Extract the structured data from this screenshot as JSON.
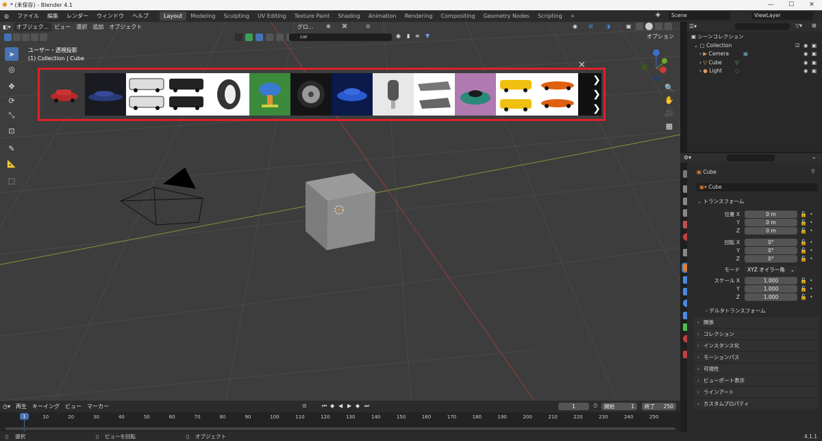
{
  "window": {
    "title": "* (未保存) - Blender 4.1",
    "minimize": "—",
    "maximize": "☐",
    "close": "✕"
  },
  "menu": [
    "ファイル",
    "編集",
    "レンダー",
    "ウィンドウ",
    "ヘルプ"
  ],
  "workspaces": [
    "Layout",
    "Modeling",
    "Sculpting",
    "UV Editing",
    "Texture Paint",
    "Shading",
    "Animation",
    "Rendering",
    "Compositing",
    "Geometry Nodes",
    "Scripting"
  ],
  "add_workspace": "+",
  "scene": {
    "label": "Scene",
    "viewlayer": "ViewLayer"
  },
  "viewport": {
    "mode": "オブジェク...",
    "menus": [
      "ビュー",
      "選択",
      "追加",
      "オブジェクト"
    ],
    "transform": "グロ...",
    "search_value": "car",
    "options": "オプション",
    "view_label": "ユーザー・透視投影",
    "collection_label": "(1) Collection | Cube",
    "close": "✕"
  },
  "asset_strip": {
    "items": [
      "red-classic-car",
      "blue-sports-car",
      "police-suv",
      "tire",
      "spring-rider-toy",
      "alloy-wheel",
      "blue-sedan",
      "car-key",
      "wrecked-car",
      "bumper-car",
      "yellow-taxi",
      "orange-supercar"
    ],
    "next_arrows": [
      "❯",
      "❯",
      "❯"
    ]
  },
  "outliner": {
    "root": "シーンコレクション",
    "collection": "Collection",
    "items": [
      "Camera",
      "Cube",
      "Light"
    ]
  },
  "properties": {
    "object_name": "Cube",
    "datablock": "Cube",
    "transform_header": "トランスフォーム",
    "location_label": "位置 X",
    "rotation_label": "回転 X",
    "scale_label": "スケール X",
    "y": "Y",
    "z": "Z",
    "location": [
      "0 m",
      "0 m",
      "0 m"
    ],
    "rotation": [
      "0°",
      "0°",
      "0°"
    ],
    "scale": [
      "1.000",
      "1.000",
      "1.000"
    ],
    "mode_label": "モード",
    "mode_value": "XYZ オイラー角",
    "delta": "デルタトランスフォーム",
    "sections": [
      "関係",
      "コレクション",
      "インスタンス化",
      "モーションパス",
      "可視性",
      "ビューポート表示",
      "ラインアート",
      "カスタムプロパティ"
    ]
  },
  "timeline": {
    "menus": [
      "再生",
      "キーイング",
      "ビュー",
      "マーカー"
    ],
    "current_frame": "1",
    "start_label": "開始",
    "start": "1",
    "end_label": "終了",
    "end": "250",
    "ticks": [
      "1",
      "10",
      "20",
      "30",
      "40",
      "50",
      "60",
      "70",
      "80",
      "90",
      "100",
      "110",
      "120",
      "130",
      "140",
      "150",
      "160",
      "170",
      "180",
      "190",
      "200",
      "210",
      "220",
      "230",
      "240",
      "250"
    ]
  },
  "statusbar": {
    "select": "選択",
    "rotate": "ビューを回転",
    "object": "オブジェクト",
    "version": "4.1.1"
  }
}
